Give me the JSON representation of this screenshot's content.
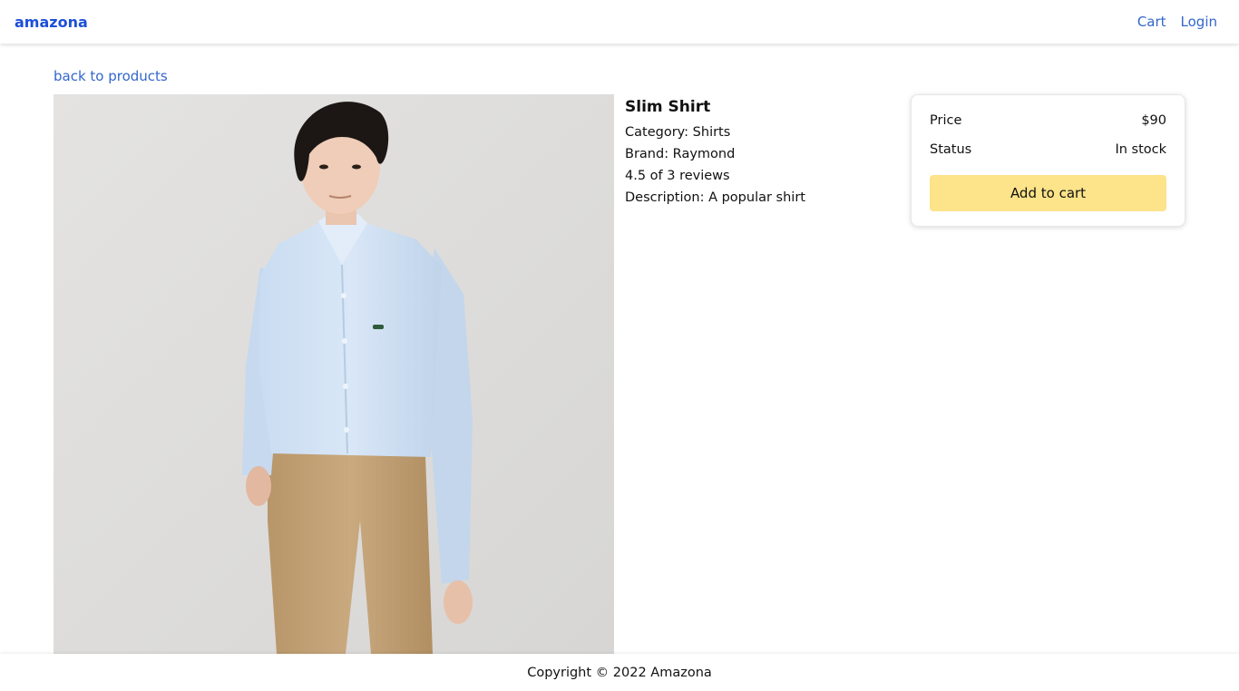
{
  "header": {
    "brand": "amazona",
    "nav": {
      "cart": "Cart",
      "login": "Login"
    }
  },
  "back_link": "back to products",
  "product": {
    "image_alt": "Slim Shirt",
    "name": "Slim Shirt",
    "category": "Category: Shirts",
    "brand": "Brand: Raymond",
    "rating": "4.5 of 3 reviews",
    "description": "Description: A popular shirt"
  },
  "action": {
    "price_label": "Price",
    "price_value": "$90",
    "status_label": "Status",
    "status_value": "In stock",
    "add_button": "Add to cart"
  },
  "footer": {
    "copyright": "Copyright © 2022 Amazona"
  },
  "colors": {
    "brand": "#1d4fd8",
    "link": "#3366cc",
    "button": "#fde389"
  }
}
